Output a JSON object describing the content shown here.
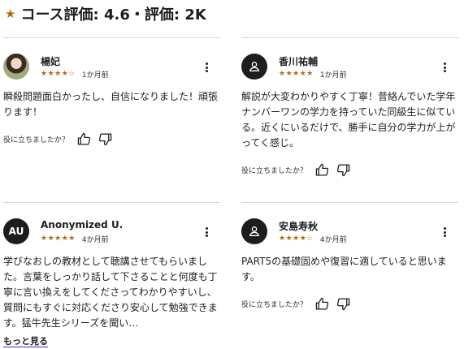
{
  "header": {
    "title": "コース評価: 4.6・評価: 2K",
    "accent": "#b4690e"
  },
  "reviews": [
    {
      "name": "楊妃",
      "rating": 4.5,
      "stars": "★★★★☆",
      "age": "1か月前",
      "avatar": "photo",
      "text": "瞬殺問題面白かったし、自信になりました！頑張ります！",
      "helpful_label": "役に立ちましたか？"
    },
    {
      "name": "香川祐輔",
      "rating": 5,
      "stars": "★★★★★",
      "age": "1か月前",
      "avatar": "user-icon",
      "text": "解説が大変わかりやすく丁寧！昔絡んでいた学年ナンバーワンの学力を持っていた同級生に似ている。近くにいるだけで、勝手に自分の学力が上がってく感じ。",
      "helpful_label": "役に立ちましたか？"
    },
    {
      "name": "Anonymized U.",
      "initials": "AU",
      "rating": 5,
      "stars": "★★★★★",
      "age": "4か月前",
      "avatar": "initials",
      "text": "学びなおしの教材として聴講させてもらいました。言葉をしっかり話して下さることと何度も丁寧に言い換えをしてくださってわかりやすいし、質問にもすぐに対応くださり安心して勉強できます。猛牛先生シリーズを聞い…",
      "more_label": "もっと見る"
    },
    {
      "name": "安島寿秋",
      "rating": 4,
      "stars": "★★★★☆",
      "age": "4か月前",
      "avatar": "user-icon",
      "text": "PART5の基礎固めや復習に適していると思います。",
      "helpful_label": "役に立ちましたか？"
    }
  ]
}
